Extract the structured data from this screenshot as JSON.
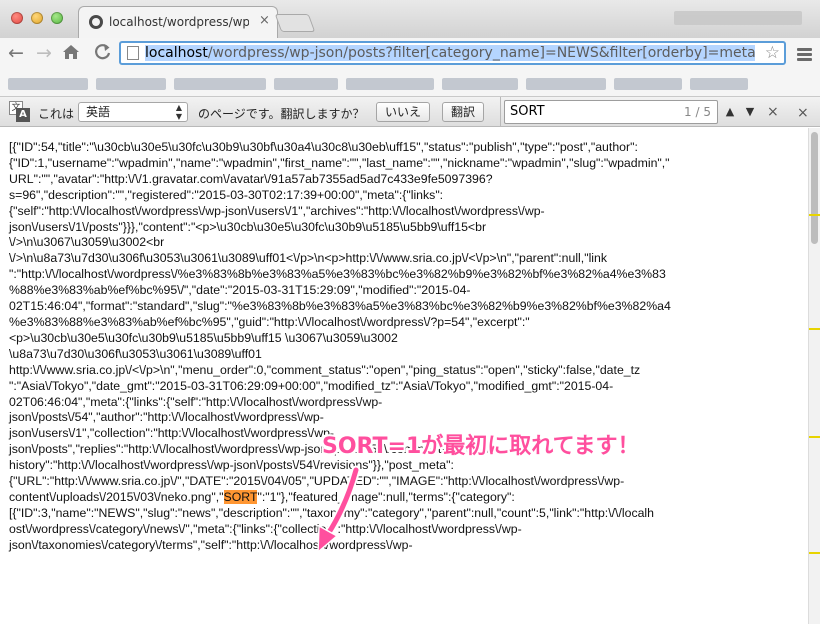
{
  "window": {
    "tab_title": "localhost/wordpress/wp-j",
    "tab_close": "×"
  },
  "toolbar": {
    "back": "←",
    "forward": "→",
    "reload": "C",
    "url_host": "localhost",
    "url_path": "/wordpress/wp-json/posts?filter[category_name]=NEWS&filter[orderby]=meta_va",
    "star": "☆"
  },
  "translate": {
    "prefix": "これは",
    "language": "英語",
    "question": "のページです。翻訳しますか？",
    "no_label": "いいえ",
    "yes_label": "翻訳"
  },
  "find": {
    "query": "SORT",
    "count": "1 / 5",
    "up": "▲",
    "down": "▼",
    "close": "×"
  },
  "infobar": {
    "close": "×"
  },
  "content": {
    "before_match": "[{\"ID\":54,\"title\":\"\\u30cb\\u30e5\\u30fc\\u30b9\\u30bf\\u30a4\\u30c8\\u30eb\\uff15\",\"status\":\"publish\",\"type\":\"post\",\"author\":\n{\"ID\":1,\"username\":\"wpadmin\",\"name\":\"wpadmin\",\"first_name\":\"\",\"last_name\":\"\",\"nickname\":\"wpadmin\",\"slug\":\"wpadmin\",\"\nURL\":\"\",\"avatar\":\"http:\\/\\/1.gravatar.com\\/avatar\\/91a57ab7355ad5ad7c433e9fe5097396?\ns=96\",\"description\":\"\",\"registered\":\"2015-03-30T02:17:39+00:00\",\"meta\":{\"links\":\n{\"self\":\"http:\\/\\/localhost\\/wordpress\\/wp-json\\/users\\/1\",\"archives\":\"http:\\/\\/localhost\\/wordpress\\/wp-\njson\\/users\\/1\\/posts\"}}},\"content\":\"<p>\\u30cb\\u30e5\\u30fc\\u30b9\\u5185\\u5bb9\\uff15<br\n\\/>\\n\\u3067\\u3059\\u3002<br\n\\/>\\n\\u8a73\\u7d30\\u306f\\u3053\\u3061\\u3089\\uff01<\\/p>\\n<p>http:\\/\\/www.sria.co.jp\\/<\\/p>\\n\",\"parent\":null,\"link\n\":\"http:\\/\\/localhost\\/wordpress\\/%e3%83%8b%e3%83%a5%e3%83%bc%e3%82%b9%e3%82%bf%e3%82%a4%e3%83\n%88%e3%83%ab%ef%bc%95\\/\",\"date\":\"2015-03-31T15:29:09\",\"modified\":\"2015-04-\n02T15:46:04\",\"format\":\"standard\",\"slug\":\"%e3%83%8b%e3%83%a5%e3%83%bc%e3%82%b9%e3%82%bf%e3%82%a4\n%e3%83%88%e3%83%ab%ef%bc%95\",\"guid\":\"http:\\/\\/localhost\\/wordpress\\/?p=54\",\"excerpt\":\"\n<p>\\u30cb\\u30e5\\u30fc\\u30b9\\u5185\\u5bb9\\uff15 \\u3067\\u3059\\u3002\n\\u8a73\\u7d30\\u306f\\u3053\\u3061\\u3089\\uff01\nhttp:\\/\\/www.sria.co.jp\\/<\\/p>\\n\",\"menu_order\":0,\"comment_status\":\"open\",\"ping_status\":\"open\",\"sticky\":false,\"date_tz\n\":\"Asia\\/Tokyo\",\"date_gmt\":\"2015-03-31T06:29:09+00:00\",\"modified_tz\":\"Asia\\/Tokyo\",\"modified_gmt\":\"2015-04-\n02T06:46:04\",\"meta\":{\"links\":{\"self\":\"http:\\/\\/localhost\\/wordpress\\/wp-\njson\\/posts\\/54\",\"author\":\"http:\\/\\/localhost\\/wordpress\\/wp-\njson\\/users\\/1\",\"collection\":\"http:\\/\\/localhost\\/wordpress\\/wp-\njson\\/posts\",\"replies\":\"http:\\/\\/localhost\\/wordpress\\/wp-json\\/posts\\/54\\/comments\",\"version-\nhistory\":\"http:\\/\\/localhost\\/wordpress\\/wp-json\\/posts\\/54\\/revisions\"}},\"post_meta\":\n{\"URL\":\"http:\\/\\/www.sria.co.jp\\/\",\"DATE\":\"2015\\/04\\/05\",\"UPDATED\":\"\",\"IMAGE\":\"http:\\/\\/localhost\\/wordpress\\/wp-\ncontent\\/uploads\\/2015\\/03\\/neko.png\",\"",
    "match": "SORT",
    "after_match": "\":\"1\"},\"featured_image\":null,\"terms\":{\"category\":\n[{\"ID\":3,\"name\":\"NEWS\",\"slug\":\"news\",\"description\":\"\",\"taxonomy\":\"category\",\"parent\":null,\"count\":5,\"link\":\"http:\\/\\/localh\nost\\/wordpress\\/category\\/news\\/\",\"meta\":{\"links\":{\"collection\":\"http:\\/\\/localhost\\/wordpress\\/wp-\njson\\/taxonomies\\/category\\/terms\",\"self\":\"http:\\/\\/localhost\\/wordpress\\/wp-"
  },
  "annotation": {
    "text": "SORT=1が最初に取れてます！",
    "color": "#ff4f9e"
  },
  "colors": {
    "find_highlight_active": "#ff9632",
    "omnibox_focus": "#5b9dd9",
    "url_selection": "#b5d5ff"
  }
}
